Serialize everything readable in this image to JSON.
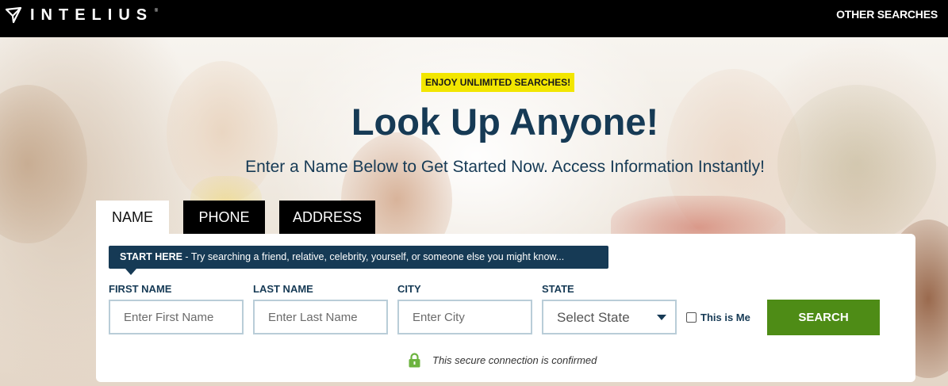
{
  "header": {
    "brand": "INTELIUS",
    "brand_mark": "®",
    "other_searches": "OTHER SEARCHES"
  },
  "hero": {
    "promo": "ENJOY UNLIMITED SEARCHES!",
    "headline": "Look Up Anyone!",
    "subheadline": "Enter a Name Below to Get Started Now. Access Information Instantly!"
  },
  "tabs": [
    {
      "label": "NAME",
      "active": true
    },
    {
      "label": "PHONE",
      "active": false
    },
    {
      "label": "ADDRESS",
      "active": false
    }
  ],
  "form": {
    "tip_strong": "START HERE",
    "tip_text": " - Try searching a friend, relative, celebrity, yourself, or someone else you might know...",
    "first_name": {
      "label": "FIRST NAME",
      "placeholder": "Enter First Name",
      "value": ""
    },
    "last_name": {
      "label": "LAST NAME",
      "placeholder": "Enter Last Name",
      "value": ""
    },
    "city": {
      "label": "CITY",
      "placeholder": "Enter City",
      "value": ""
    },
    "state": {
      "label": "STATE",
      "selected": "Select State"
    },
    "this_is_me": {
      "label": "This is Me",
      "checked": false
    },
    "search_button": "SEARCH",
    "secure_note": "This secure connection is confirmed"
  },
  "colors": {
    "navy": "#163a55",
    "promo_yellow": "#f2e600",
    "search_green": "#4e8c16",
    "lock_green": "#6cb33f"
  },
  "icons": {
    "logo": "paper-plane-icon",
    "state_caret": "chevron-down-icon",
    "secure": "lock-icon"
  }
}
